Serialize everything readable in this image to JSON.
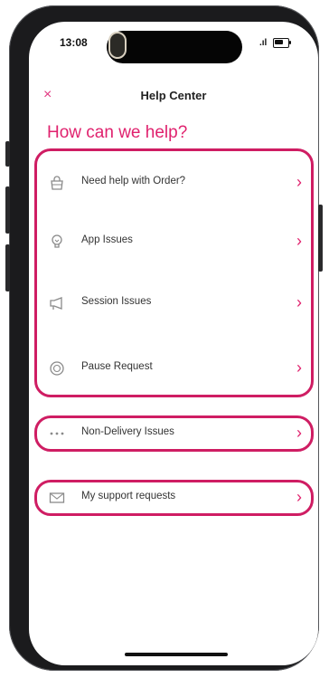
{
  "status_bar": {
    "time": "13:08",
    "signal": ".ıl"
  },
  "header": {
    "close_glyph": "×",
    "title": "Help Center"
  },
  "headline": "How can we help?",
  "menu_items": [
    {
      "label": "Need help with Order?",
      "icon": "bag-icon"
    },
    {
      "label": "App Issues",
      "icon": "lightbulb-icon"
    },
    {
      "label": "Session Issues",
      "icon": "megaphone-icon"
    },
    {
      "label": "Pause Request",
      "icon": "pause-circle-icon"
    },
    {
      "label": "Non-Delivery Issues",
      "icon": "more-dots-icon"
    },
    {
      "label": "My support requests",
      "icon": "mail-icon"
    }
  ],
  "colors": {
    "accent": "#e0226e",
    "outline": "#cf1d63"
  }
}
